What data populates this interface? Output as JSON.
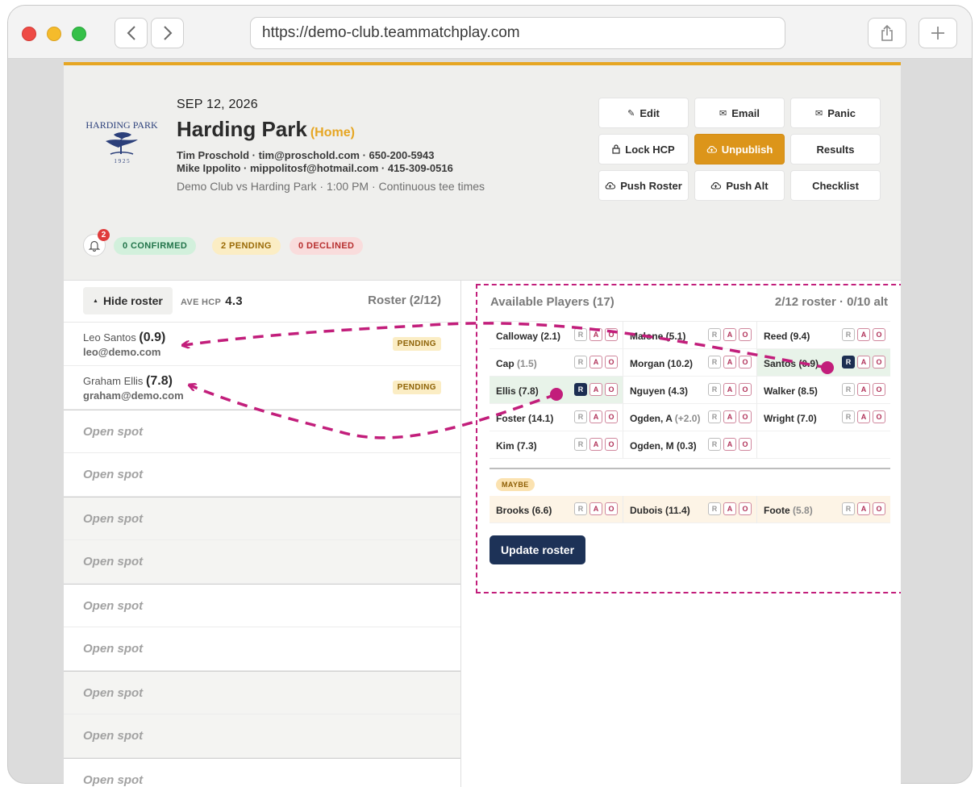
{
  "browser": {
    "url": "https://demo-club.teammatchplay.com"
  },
  "logo": {
    "text": "HARDING PARK",
    "year": "1 9 2 5"
  },
  "header": {
    "date": "SEP 12, 2026",
    "title": "Harding Park",
    "home_label": "(Home)",
    "contact1": "Tim Proschold · tim@proschold.com · 650-200-5943",
    "contact2": "Mike Ippolito · mippolitosf@hotmail.com · 415-309-0516",
    "match_line": "Demo Club vs Harding Park · 1:00 PM · Continuous tee times"
  },
  "actions": {
    "edit": "Edit",
    "email": "Email",
    "panic": "Panic",
    "lock_hcp": "Lock HCP",
    "unpublish": "Unpublish",
    "results": "Results",
    "push_roster": "Push Roster",
    "push_alt": "Push Alt",
    "checklist": "Checklist"
  },
  "status": {
    "bell_count": "2",
    "confirmed": "0 CONFIRMED",
    "pending": "2 PENDING",
    "declined": "0 DECLINED"
  },
  "roster": {
    "hide_label": "Hide roster",
    "ave_hcp_label": "AVE HCP",
    "ave_hcp_value": "4.3",
    "count_label": "Roster (2/12)",
    "players": [
      {
        "name": "Leo Santos",
        "hcp": "(0.9)",
        "email": "leo@demo.com",
        "status": "PENDING"
      },
      {
        "name": "Graham Ellis",
        "hcp": "(7.8)",
        "email": "graham@demo.com",
        "status": "PENDING"
      }
    ],
    "open_label": "Open spot"
  },
  "available": {
    "title": "Available Players (17)",
    "summary": "2/12 roster · 0/10 alt",
    "rao": {
      "r": "R",
      "a": "A",
      "o": "O"
    },
    "players": [
      {
        "name": "Calloway (2.1)",
        "hcp": ""
      },
      {
        "name": "Malone (5.1)",
        "hcp": ""
      },
      {
        "name": "Reed (9.4)",
        "hcp": ""
      },
      {
        "name": "Cap",
        "hcp": "(1.5)"
      },
      {
        "name": "Morgan (10.2)",
        "hcp": ""
      },
      {
        "name": "Santos (0.9)",
        "hcp": ""
      },
      {
        "name": "Ellis (7.8)",
        "hcp": ""
      },
      {
        "name": "Nguyen (4.3)",
        "hcp": ""
      },
      {
        "name": "Walker (8.5)",
        "hcp": ""
      },
      {
        "name": "Foster (14.1)",
        "hcp": ""
      },
      {
        "name": "Ogden, A",
        "hcp": "(+2.0)"
      },
      {
        "name": "Wright (7.0)",
        "hcp": ""
      },
      {
        "name": "Kim (7.3)",
        "hcp": ""
      },
      {
        "name": "Ogden, M (0.3)",
        "hcp": ""
      }
    ],
    "maybe_label": "MAYBE",
    "maybe_players": [
      {
        "name": "Brooks (6.6)",
        "hcp": ""
      },
      {
        "name": "Dubois (11.4)",
        "hcp": ""
      },
      {
        "name": "Foote",
        "hcp": "(5.8)"
      }
    ],
    "update_label": "Update roster"
  },
  "colors": {
    "accent": "#e6a623",
    "primary_button": "#dc951a",
    "navy": "#1d3257",
    "annotation": "#c21e7b"
  }
}
